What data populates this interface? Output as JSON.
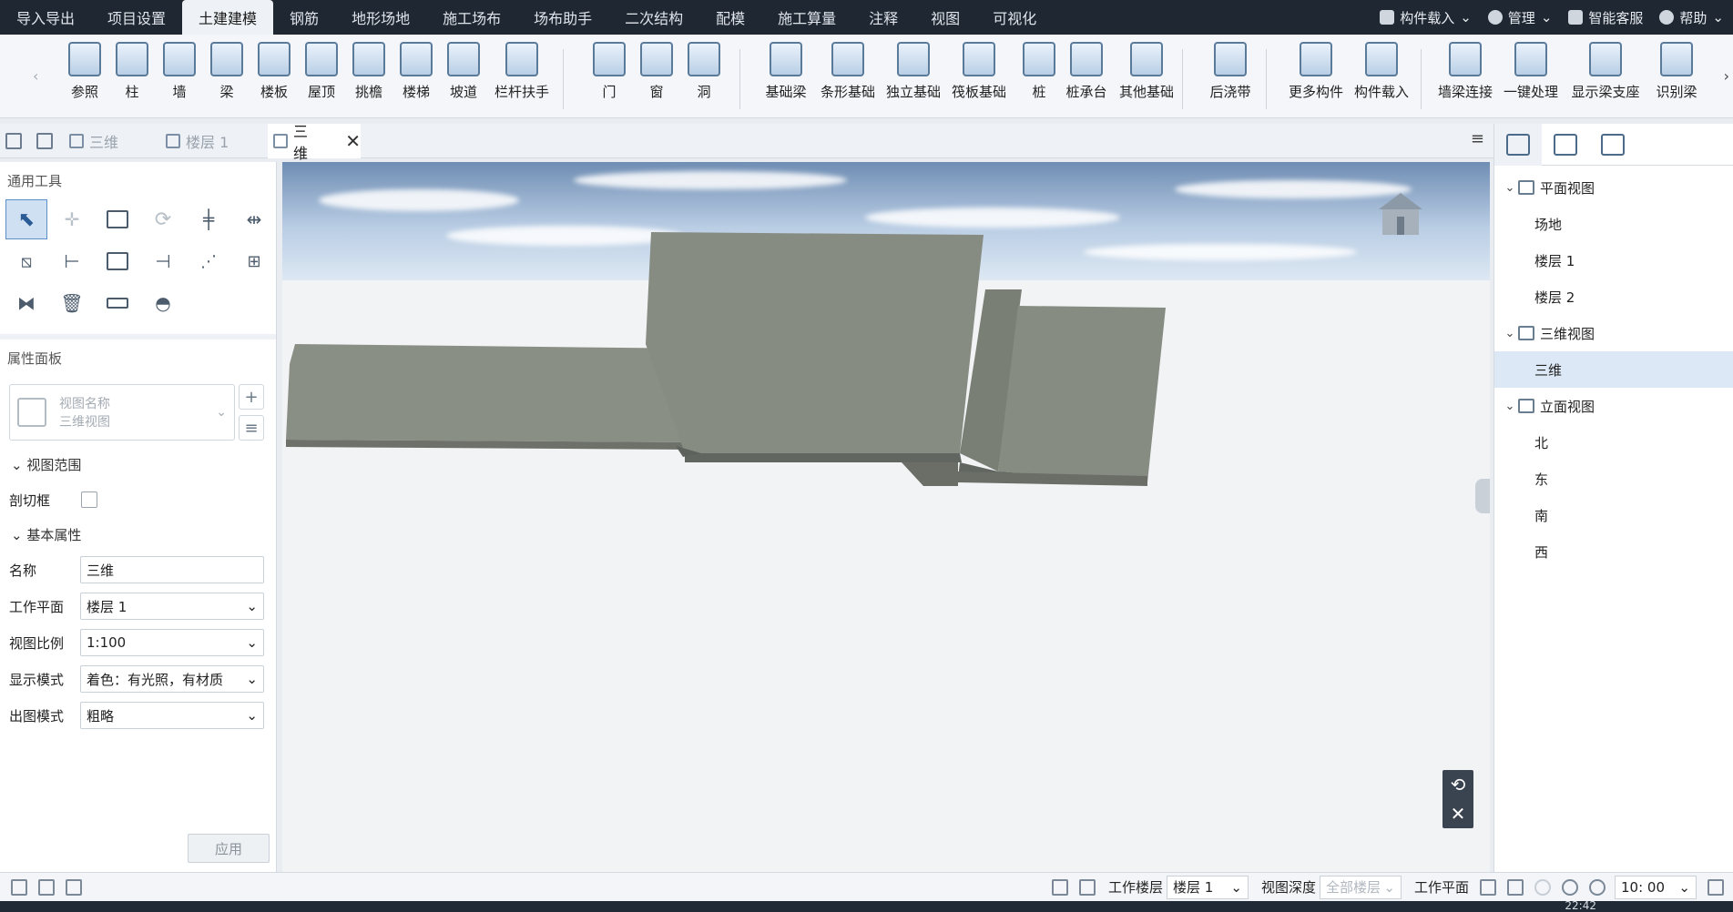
{
  "menu": {
    "tabs": [
      "导入导出",
      "项目设置",
      "土建建模",
      "钢筋",
      "地形场地",
      "施工场布",
      "场布助手",
      "二次结构",
      "配模",
      "施工算量",
      "注释",
      "视图",
      "可视化"
    ],
    "active_index": 2,
    "right": {
      "component_load": "构件载入",
      "manage": "管理",
      "service": "智能客服",
      "help": "帮助"
    }
  },
  "ribbon": {
    "buttons": [
      {
        "label": "参照",
        "icon": "reference-icon"
      },
      {
        "label": "柱",
        "icon": "column-icon"
      },
      {
        "label": "墙",
        "icon": "wall-icon"
      },
      {
        "label": "梁",
        "icon": "beam-icon"
      },
      {
        "label": "楼板",
        "icon": "slab-icon"
      },
      {
        "label": "屋顶",
        "icon": "roof-icon"
      },
      {
        "label": "挑檐",
        "icon": "eave-icon"
      },
      {
        "label": "楼梯",
        "icon": "stair-icon"
      },
      {
        "label": "坡道",
        "icon": "ramp-icon"
      },
      {
        "label": "栏杆扶手",
        "icon": "railing-icon"
      },
      {
        "label": "门",
        "icon": "door-icon"
      },
      {
        "label": "窗",
        "icon": "window-icon"
      },
      {
        "label": "洞",
        "icon": "opening-icon"
      },
      {
        "label": "基础梁",
        "icon": "foundation-beam-icon"
      },
      {
        "label": "条形基础",
        "icon": "strip-foundation-icon"
      },
      {
        "label": "独立基础",
        "icon": "isolated-foundation-icon"
      },
      {
        "label": "筏板基础",
        "icon": "raft-foundation-icon"
      },
      {
        "label": "桩",
        "icon": "pile-icon"
      },
      {
        "label": "桩承台",
        "icon": "pile-cap-icon"
      },
      {
        "label": "其他基础",
        "icon": "other-foundation-icon"
      },
      {
        "label": "后浇带",
        "icon": "post-pour-strip-icon"
      },
      {
        "label": "更多构件",
        "icon": "more-components-icon"
      },
      {
        "label": "构件载入",
        "icon": "component-load-icon"
      },
      {
        "label": "墙梁连接",
        "icon": "wall-beam-connect-icon"
      },
      {
        "label": "一键处理",
        "icon": "one-click-process-icon"
      },
      {
        "label": "显示梁支座",
        "icon": "show-beam-support-icon"
      },
      {
        "label": "识别梁",
        "icon": "identify-beam-icon"
      }
    ],
    "nav_left": "‹",
    "nav_right": "›"
  },
  "doc_tabs": {
    "tabs": [
      {
        "label": "三维",
        "active": false
      },
      {
        "label": "楼层 1",
        "active": false
      },
      {
        "label": "三维",
        "active": true
      }
    ],
    "close_glyph": "✕",
    "menu_glyph": "≡"
  },
  "left_panel": {
    "tools_title": "通用工具",
    "properties_title": "属性面板",
    "view_name_placeholder": "视图名称",
    "view_type": "三维视图",
    "groups": {
      "view_range": "视图范围",
      "basic": "基本属性"
    },
    "section_box_label": "剖切框",
    "fields": [
      {
        "label": "名称",
        "value": "三维",
        "dropdown": false
      },
      {
        "label": "工作平面",
        "value": "楼层 1",
        "dropdown": true
      },
      {
        "label": "视图比例",
        "value": "1:100",
        "dropdown": true
      },
      {
        "label": "显示模式",
        "value": "着色：有光照，有材质",
        "dropdown": true
      },
      {
        "label": "出图模式",
        "value": "粗略",
        "dropdown": true
      }
    ],
    "apply_label": "应用"
  },
  "tree": {
    "groups": [
      {
        "label": "平面视图",
        "children": [
          "场地",
          "楼层 1",
          "楼层 2"
        ]
      },
      {
        "label": "三维视图",
        "children": [
          "三维"
        ]
      },
      {
        "label": "立面视图",
        "children": [
          "北",
          "东",
          "南",
          "西"
        ]
      }
    ],
    "selected": "三维"
  },
  "status": {
    "work_floor_label": "工作楼层",
    "work_floor_value": "楼层 1",
    "view_depth_label": "视图深度",
    "view_depth_value": "全部楼层",
    "work_plane_label": "工作平面",
    "time_value": "10: 00"
  },
  "taskbar": {
    "clock": "22:42"
  },
  "colors": {
    "accent": "#5b8fc9",
    "topbar": "#1f2733",
    "solid": "#858a81"
  }
}
